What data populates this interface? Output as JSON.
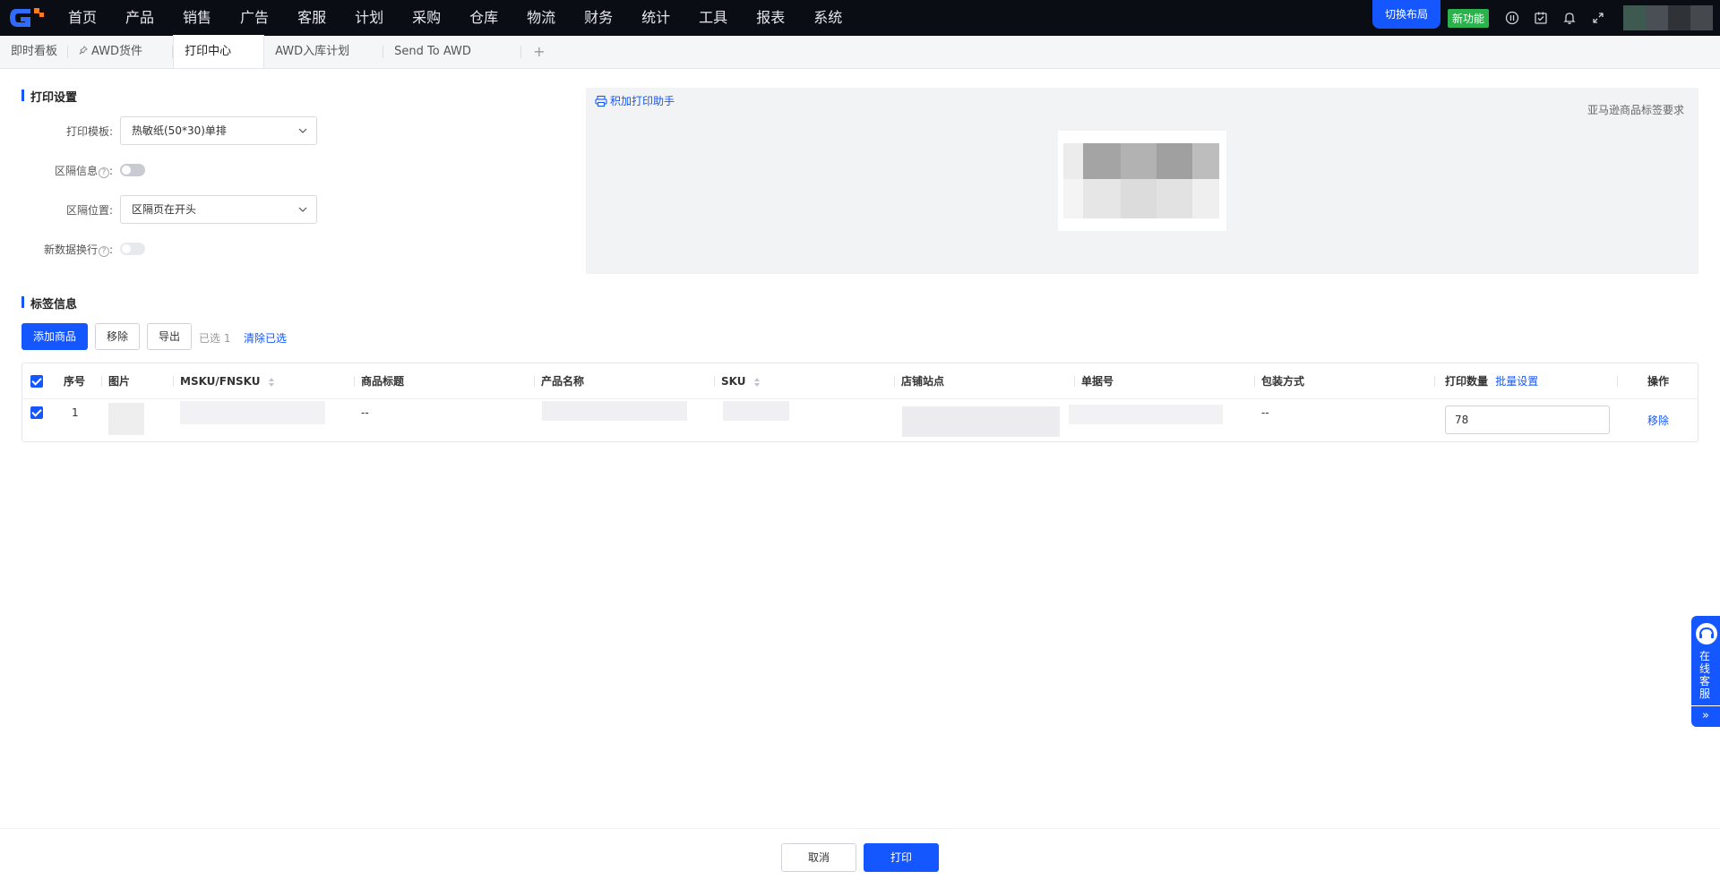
{
  "nav": {
    "items": [
      "首页",
      "产品",
      "销售",
      "广告",
      "客服",
      "计划",
      "采购",
      "仓库",
      "物流",
      "财务",
      "统计",
      "工具",
      "报表",
      "系统"
    ],
    "switch_layout": "切换布局",
    "new_feature": "新功能"
  },
  "tabs": {
    "items": [
      "即时看板",
      "AWD货件",
      "打印中心",
      "AWD入库计划",
      "Send To AWD"
    ],
    "add": "+"
  },
  "print_settings": {
    "title": "打印设置",
    "template_label": "打印模板:",
    "template_value": "热敏纸(50*30)单排",
    "separator_info_label": "区隔信息",
    "separator_pos_label": "区隔位置:",
    "separator_pos_value": "区隔页在开头",
    "new_line_label": "新数据换行",
    "colon": ":",
    "help": "?"
  },
  "preview": {
    "assistant_link": "积加打印助手",
    "amazon_req": "亚马逊商品标签要求"
  },
  "label_info": {
    "title": "标签信息",
    "add_btn": "添加商品",
    "remove_btn": "移除",
    "export_btn": "导出",
    "selected": "已选 1",
    "clear_selected": "清除已选"
  },
  "table": {
    "headers": {
      "index": "序号",
      "image": "图片",
      "msku": "MSKU/FNSKU",
      "title": "商品标题",
      "name": "产品名称",
      "sku": "SKU",
      "shop": "店铺站点",
      "order_no": "单据号",
      "packing": "包装方式",
      "qty": "打印数量",
      "batch_set": "批量设置",
      "action": "操作"
    },
    "rows": [
      {
        "index": "1",
        "title": "--",
        "packing": "--",
        "qty": "78",
        "action": "移除"
      }
    ]
  },
  "footer": {
    "cancel": "取消",
    "print": "打印"
  },
  "service": {
    "text": "在线客服",
    "expand": "»"
  }
}
